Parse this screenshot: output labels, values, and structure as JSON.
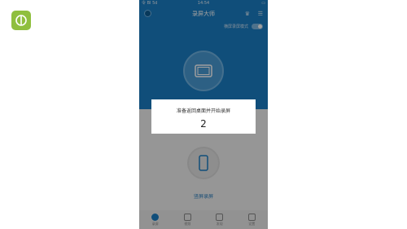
{
  "statusbar": {
    "left": "令 BI 5d",
    "time": "14:54",
    "right": "▭"
  },
  "app": {
    "title": "录屏大师"
  },
  "toggle": {
    "label": "横屏录屏模式"
  },
  "dialog": {
    "message": "准备返回桌面并开始录屏",
    "countdown": "2"
  },
  "secondary": {
    "label": "竖屏录屏"
  },
  "tabs": [
    {
      "label": "录屏"
    },
    {
      "label": "视频"
    },
    {
      "label": "发现"
    },
    {
      "label": "设置"
    }
  ],
  "colors": {
    "accent": "#1b7fc6",
    "logo": "#8fbf3e"
  }
}
